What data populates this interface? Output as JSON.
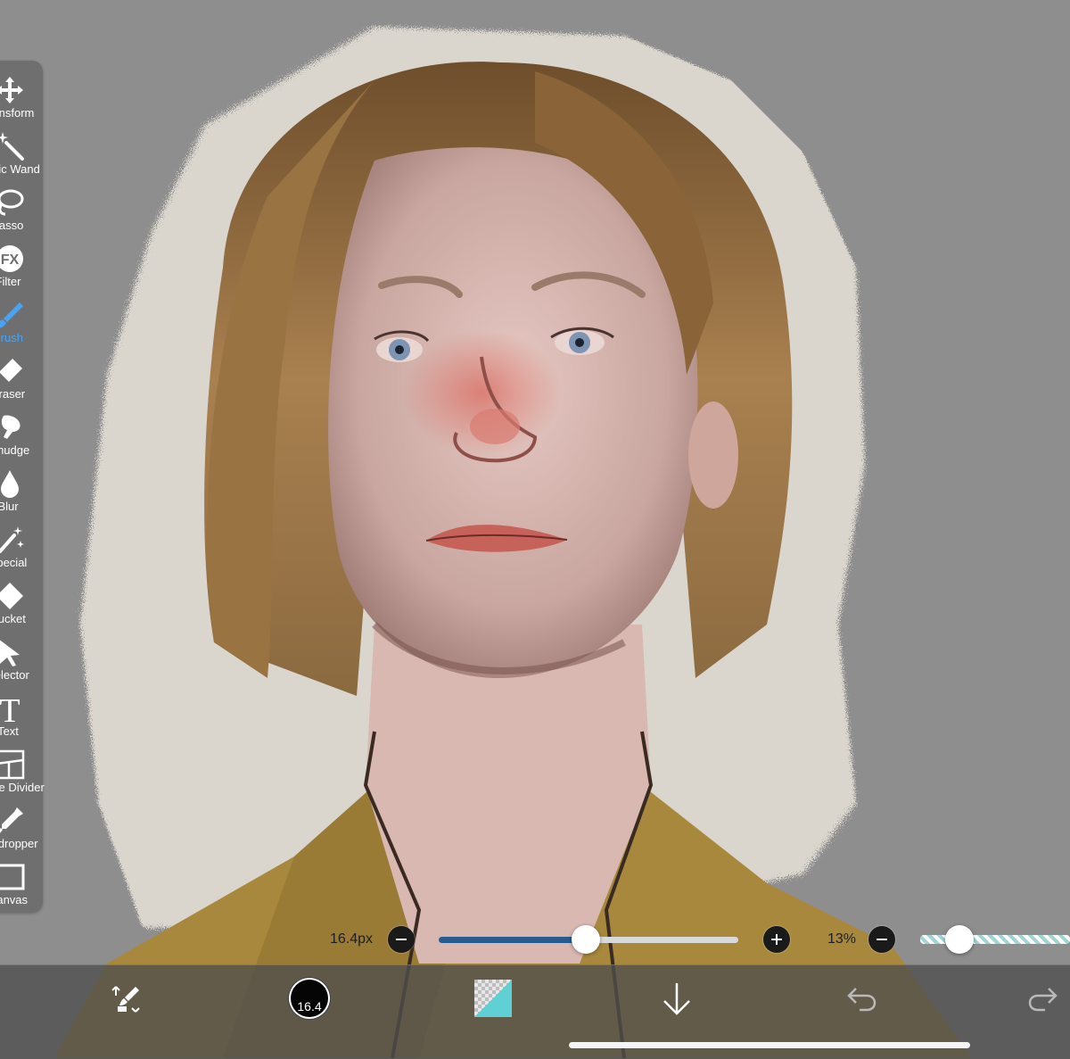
{
  "tools": [
    {
      "name": "transform",
      "label": "Transform",
      "icon": "move-arrows-icon"
    },
    {
      "name": "magic-wand",
      "label": "Magic Wand",
      "icon": "magic-wand-icon"
    },
    {
      "name": "lasso",
      "label": "Lasso",
      "icon": "lasso-icon"
    },
    {
      "name": "filter",
      "label": "Filter",
      "icon": "fx-icon"
    },
    {
      "name": "brush",
      "label": "Brush",
      "icon": "brush-icon",
      "active": true
    },
    {
      "name": "eraser",
      "label": "Eraser",
      "icon": "eraser-icon"
    },
    {
      "name": "smudge",
      "label": "Smudge",
      "icon": "smudge-finger-icon"
    },
    {
      "name": "blur",
      "label": "Blur",
      "icon": "water-drop-icon"
    },
    {
      "name": "special",
      "label": "Special",
      "icon": "sparkle-wand-icon"
    },
    {
      "name": "bucket",
      "label": "Bucket",
      "icon": "bucket-diamond-icon"
    },
    {
      "name": "selector",
      "label": "Selector",
      "icon": "arrow-pointer-icon"
    },
    {
      "name": "text",
      "label": "Text",
      "icon": "text-t-icon"
    },
    {
      "name": "frame-divider",
      "label": "Frame Divider",
      "icon": "frame-divider-icon"
    },
    {
      "name": "eyedropper",
      "label": "Eyedropper",
      "icon": "eyedropper-icon"
    },
    {
      "name": "canvas",
      "label": "Canvas",
      "icon": "canvas-rect-icon"
    }
  ],
  "brush_size": {
    "value_label": "16.4px",
    "fraction": 0.49
  },
  "opacity": {
    "value_label": "13%",
    "fraction": 0.13
  },
  "bottom_bar": {
    "color_size_label": "16.4",
    "current_color": "#050505",
    "items": [
      "brush-eraser-swap-icon",
      "color-swatch",
      "layer-thumbnail-icon",
      "save-down-arrow-icon",
      "undo-icon",
      "redo-icon"
    ]
  },
  "colors": {
    "canvas_bg": "#8e8e8e",
    "accent_active": "#4aa3f0",
    "slider_fill": "#275a8e",
    "opacity_fill": "#9fd3d6"
  }
}
